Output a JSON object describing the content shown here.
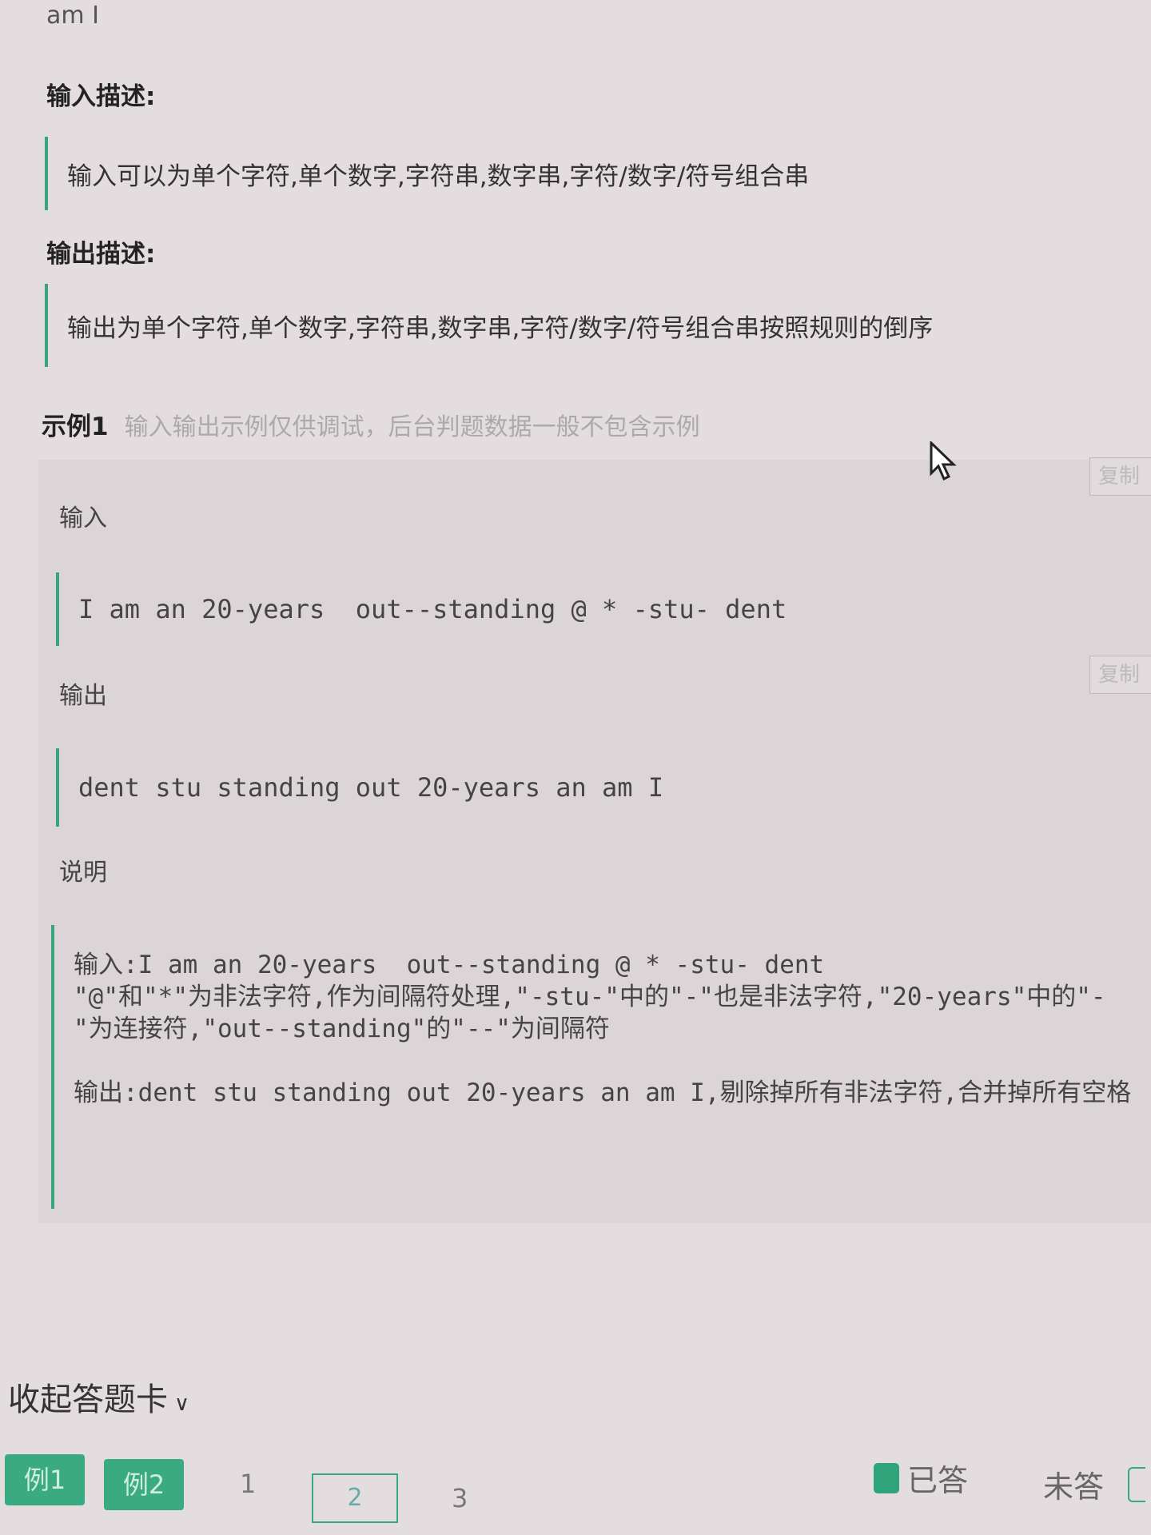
{
  "top_fragment": "am I",
  "input_desc": {
    "heading": "输入描述:",
    "text": "输入可以为单个字符,单个数字,字符串,数字串,字符/数字/符号组合串"
  },
  "output_desc": {
    "heading": "输出描述:",
    "text": "输出为单个字符,单个数字,字符串,数字串,字符/数字/符号组合串按照规则的倒序"
  },
  "example": {
    "title": "示例1",
    "note": "输入输出示例仅供调试，后台判题数据一般不包含示例",
    "copy_label": "复制",
    "input_label": "输入",
    "input_value": "I am an 20-years  out--standing @ * -stu- dent",
    "output_label": "输出",
    "output_value": "dent stu standing out 20-years an am I",
    "explain_label": "说明",
    "explain_lines": [
      "输入:I am an 20-years  out--standing @ * -stu- dent\n\"@\"和\"*\"为非法字符,作为间隔符处理,\"-stu-\"中的\"-\"也是非法字符,\"20-years\"中的\"-\"为连接符,\"out--standing\"的\"--\"为间隔符",
      "输出:dent stu standing out 20-years an am I,剔除掉所有非法字符,合并掉所有空格"
    ]
  },
  "answer_card": {
    "toggle_label": "收起答题卡",
    "examples": [
      "例1",
      "例2"
    ],
    "questions": [
      "1",
      "2",
      "3"
    ],
    "current_question": "2",
    "legend_answered": "已答",
    "legend_unanswered": "未答"
  },
  "colors": {
    "accent": "#3aaa80",
    "background": "#e4dde0"
  }
}
